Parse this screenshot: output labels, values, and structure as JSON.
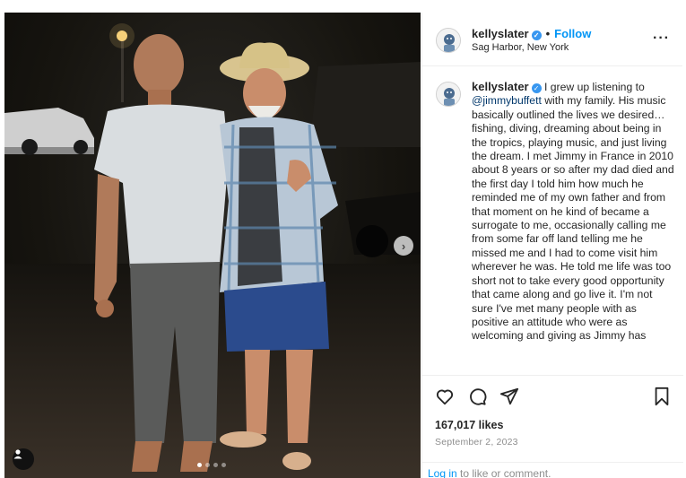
{
  "header": {
    "username": "kellyslater",
    "separator": "•",
    "follow_label": "Follow",
    "location": "Sag Harbor, New York",
    "more_icon": "more-horizontal-icon"
  },
  "caption": {
    "username": "kellyslater",
    "text_before_mention": "I grew up listening to",
    "mention": "@jimmybuffett",
    "text_after_mention": "with my family. His music basically outlined the lives we desired…fishing, diving, dreaming about being in the tropics, playing music, and just living the dream. I met Jimmy in France in 2010 about 8 years or so after my dad died and the first day I told him how much he reminded me of my own father and from that moment on he kind of became a surrogate to me, occasionally calling me from some far off land telling me he missed me and I had to come visit him wherever he was. He told me life was too short not to take every good opportunity that came along and go live it. I'm not sure I've met many people with as positive an attitude who were as welcoming and giving as Jimmy has"
  },
  "actions": {
    "like_icon": "heart-icon",
    "comment_icon": "comment-icon",
    "share_icon": "send-icon",
    "save_icon": "bookmark-icon"
  },
  "likes": "167,017 likes",
  "date": "September 2, 2023",
  "login": {
    "link_label": "Log in",
    "rest": "to like or comment."
  },
  "carousel": {
    "total_slides": 4,
    "active_slide": 1,
    "next_icon": "chevron-right-icon",
    "tag_icon": "user-tag-icon"
  },
  "colors": {
    "accent": "#0095f6",
    "verified": "#3897f0",
    "mention": "#00376b",
    "muted": "#8e8e8e"
  }
}
